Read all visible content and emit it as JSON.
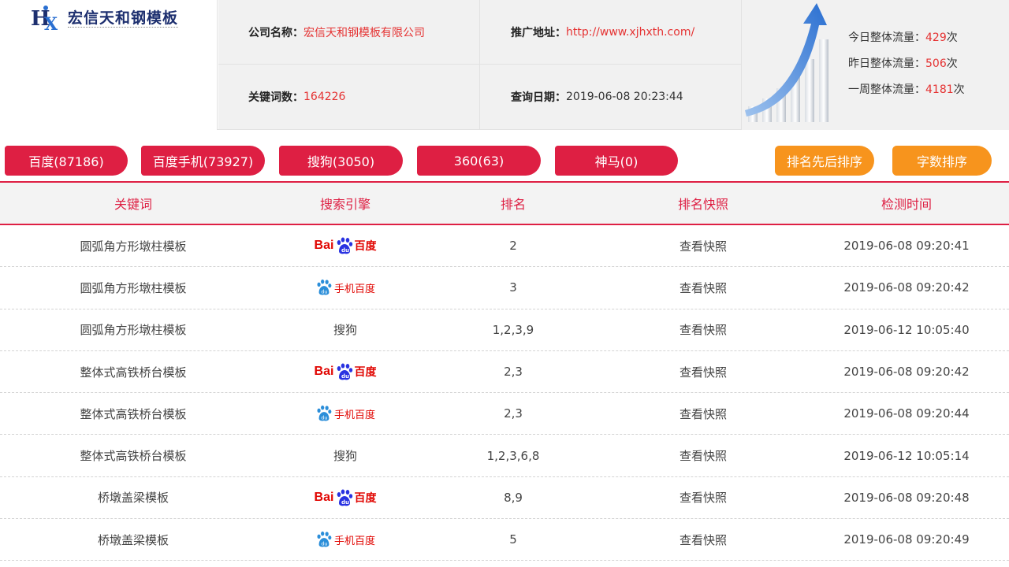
{
  "brand": {
    "name": "宏信天和钢模板",
    "mark": "HX"
  },
  "info": {
    "company_label": "公司名称：",
    "company_value": "宏信天和钢模板有限公司",
    "url_label": "推广地址：",
    "url_value": "http://www.xjhxth.com/",
    "keywords_label": "关键词数：",
    "keywords_value": "164226",
    "date_label": "查询日期：",
    "date_value": "2019-06-08 20:23:44"
  },
  "traffic": {
    "today_label": "今日整体流量：",
    "today_value": "429",
    "today_unit": "次",
    "yesterday_label": "昨日整体流量：",
    "yesterday_value": "506",
    "yesterday_unit": "次",
    "week_label": "一周整体流量：",
    "week_value": "4181",
    "week_unit": "次"
  },
  "tabs": [
    {
      "label": "百度(87186)"
    },
    {
      "label": "百度手机(73927)"
    },
    {
      "label": "搜狗(3050)"
    },
    {
      "label": "360(63)"
    },
    {
      "label": "神马(0)"
    }
  ],
  "sort": {
    "by_rank": "排名先后排序",
    "by_length": "字数排序"
  },
  "table": {
    "headers": [
      "关键词",
      "搜索引擎",
      "排名",
      "排名快照",
      "检测时间"
    ],
    "engine_text": {
      "baidu_a": "Bai",
      "baidu_b": "百度",
      "mobile": "手机百度",
      "sogou": "搜狗"
    },
    "rows": [
      {
        "keyword": "圆弧角方形墩柱模板",
        "engine": "baidu",
        "rank": "2",
        "snapshot": "查看快照",
        "time": "2019-06-08 09:20:41"
      },
      {
        "keyword": "圆弧角方形墩柱模板",
        "engine": "mobile",
        "rank": "3",
        "snapshot": "查看快照",
        "time": "2019-06-08 09:20:42"
      },
      {
        "keyword": "圆弧角方形墩柱模板",
        "engine": "sogou",
        "rank": "1,2,3,9",
        "snapshot": "查看快照",
        "time": "2019-06-12 10:05:40"
      },
      {
        "keyword": "整体式高铁桥台模板",
        "engine": "baidu",
        "rank": "2,3",
        "snapshot": "查看快照",
        "time": "2019-06-08 09:20:42"
      },
      {
        "keyword": "整体式高铁桥台模板",
        "engine": "mobile",
        "rank": "2,3",
        "snapshot": "查看快照",
        "time": "2019-06-08 09:20:44"
      },
      {
        "keyword": "整体式高铁桥台模板",
        "engine": "sogou",
        "rank": "1,2,3,6,8",
        "snapshot": "查看快照",
        "time": "2019-06-12 10:05:14"
      },
      {
        "keyword": "桥墩盖梁模板",
        "engine": "baidu",
        "rank": "8,9",
        "snapshot": "查看快照",
        "time": "2019-06-08 09:20:48"
      },
      {
        "keyword": "桥墩盖梁模板",
        "engine": "mobile",
        "rank": "5",
        "snapshot": "查看快照",
        "time": "2019-06-08 09:20:49"
      }
    ]
  },
  "colors": {
    "primary": "#de1f43",
    "accent": "#f7941d",
    "highlight": "#e53333"
  }
}
